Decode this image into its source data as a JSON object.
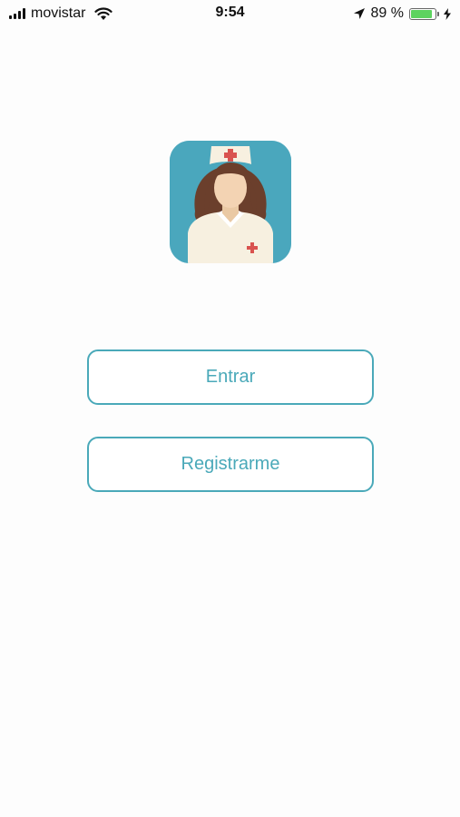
{
  "status_bar": {
    "carrier": "movistar",
    "time": "9:54",
    "battery_percent": "89 %",
    "battery_level": 0.89,
    "battery_color": "#5dd35f",
    "icons": [
      "signal-icon",
      "wifi-icon",
      "location-arrow-icon",
      "battery-icon",
      "charging-bolt-icon"
    ]
  },
  "logo": {
    "icon": "nurse-avatar-icon",
    "background_color": "#4aa7bd"
  },
  "actions": {
    "login_label": "Entrar",
    "register_label": "Registrarme",
    "accent_color": "#4aa9b9"
  }
}
